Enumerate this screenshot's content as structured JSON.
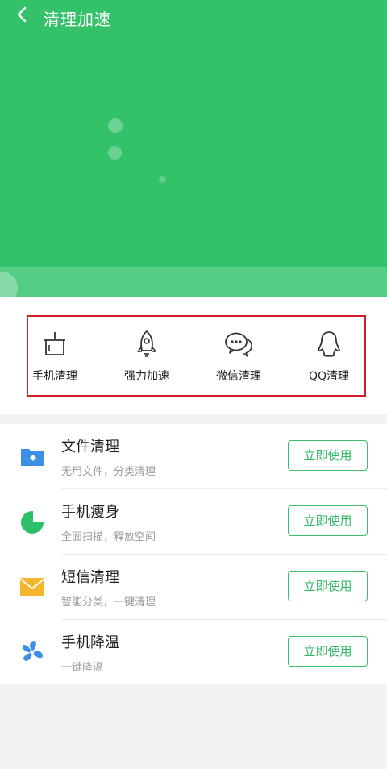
{
  "header": {
    "title": "清理加速"
  },
  "quick_actions": [
    {
      "label": "手机清理",
      "icon": "phone-clean-icon"
    },
    {
      "label": "强力加速",
      "icon": "rocket-icon"
    },
    {
      "label": "微信清理",
      "icon": "wechat-icon"
    },
    {
      "label": "QQ清理",
      "icon": "qq-penguin-icon"
    }
  ],
  "tools": [
    {
      "title": "文件清理",
      "subtitle": "无用文件，分类清理",
      "button": "立即使用",
      "icon": "folder-icon",
      "color": "#3d8fe6"
    },
    {
      "title": "手机瘦身",
      "subtitle": "全面扫描，释放空间",
      "button": "立即使用",
      "icon": "pie-chart-icon",
      "color": "#2cc06a"
    },
    {
      "title": "短信清理",
      "subtitle": "智能分类，一键清理",
      "button": "立即使用",
      "icon": "envelope-icon",
      "color": "#f5b52c"
    },
    {
      "title": "手机降温",
      "subtitle": "一键降温",
      "button": "立即使用",
      "icon": "fan-icon",
      "color": "#3d8fe6"
    }
  ],
  "colors": {
    "brand_green": "#33c16a",
    "highlight_red": "#d11f2a"
  }
}
